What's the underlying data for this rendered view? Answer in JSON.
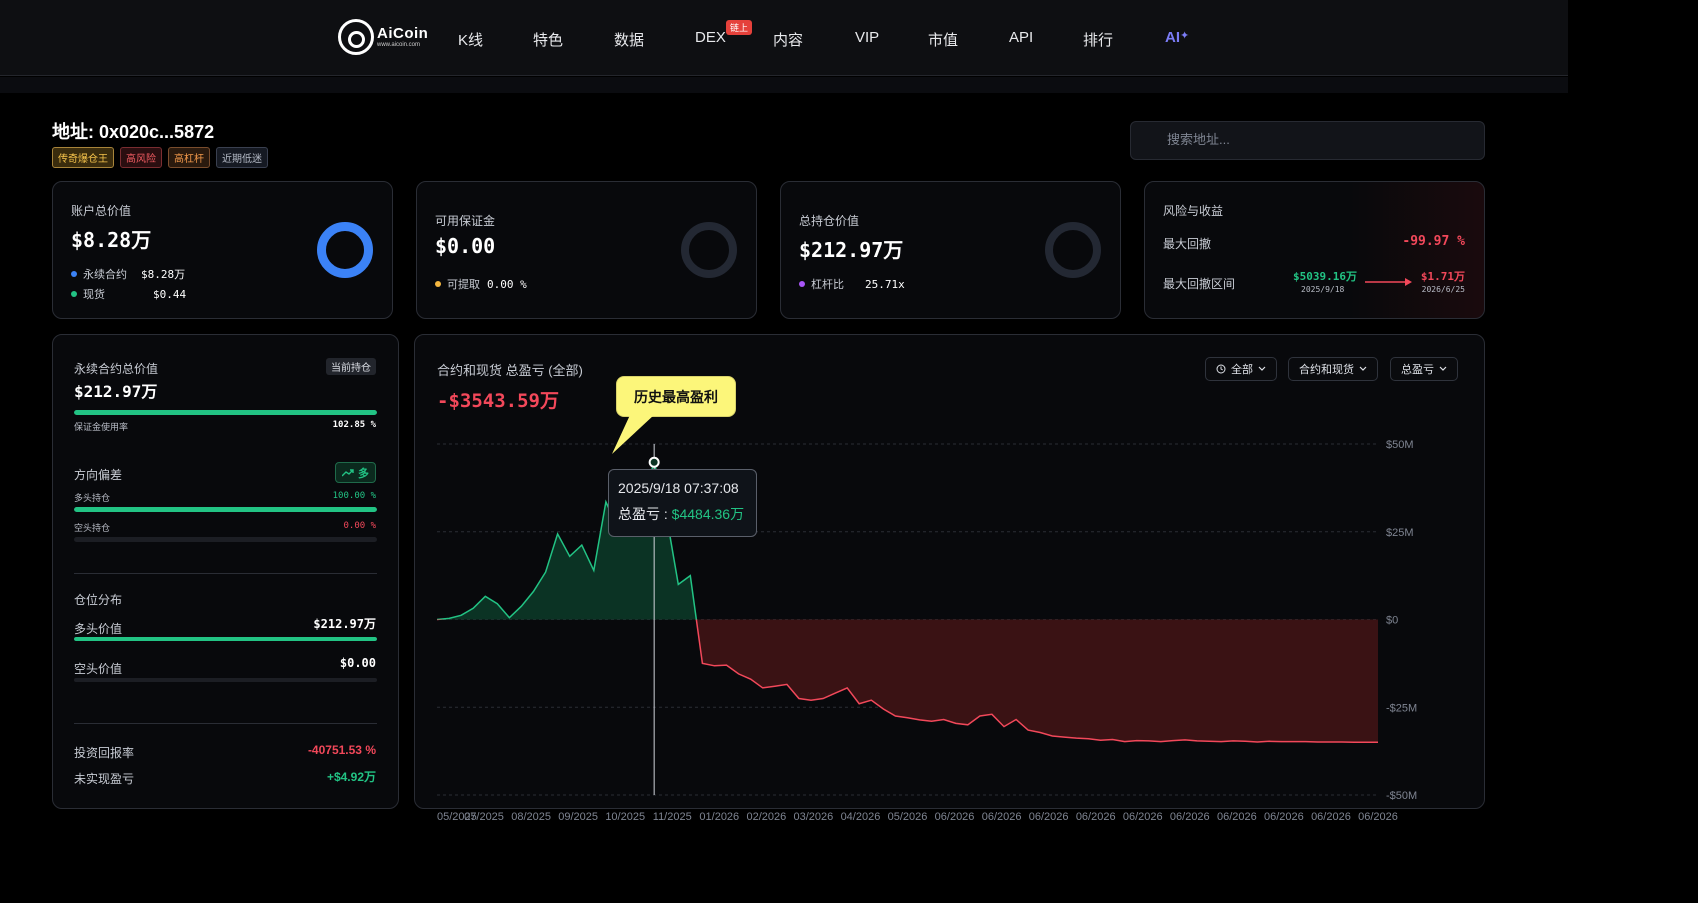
{
  "nav": {
    "logo_text": "AiCoin",
    "logo_sub": "www.aicoin.com",
    "items": [
      "K线",
      "特色",
      "数据",
      "DEX",
      "内容",
      "VIP",
      "市值",
      "API",
      "排行",
      "AI"
    ],
    "dex_badge": "链上",
    "ai_star": "✦"
  },
  "header": {
    "title": "地址: 0x020c...5872",
    "tags": [
      "传奇爆仓王",
      "高风险",
      "高杠杆",
      "近期低迷"
    ],
    "search_placeholder": "搜索地址..."
  },
  "cards": {
    "account": {
      "label": "账户总价值",
      "value": "$8.28万",
      "rows": [
        {
          "label": "永续合约",
          "value": "$8.28万"
        },
        {
          "label": "现货",
          "value": "$0.44"
        }
      ]
    },
    "margin": {
      "label": "可用保证金",
      "value": "$0.00",
      "row_label": "可提取",
      "row_value": "0.00 %"
    },
    "position": {
      "label": "总持仓价值",
      "value": "$212.97万",
      "row_label": "杠杆比",
      "row_value": "25.71x"
    },
    "risk": {
      "label": "风险与收益",
      "max_dd_label": "最大回撤",
      "max_dd_value": "-99.97 %",
      "range_label": "最大回撤区间",
      "from_value": "$5039.16万",
      "from_date": "2025/9/18",
      "to_value": "$1.71万",
      "to_date": "2026/6/25"
    }
  },
  "left": {
    "perp_label": "永续合约总价值",
    "current_badge": "当前持仓",
    "perp_value": "$212.97万",
    "margin_usage_label": "保证金使用率",
    "margin_usage_value": "102.85 %",
    "margin_usage_fraction": 1.0,
    "bias_label": "方向偏差",
    "bias_badge": "多",
    "long_hold_label": "多头持仓",
    "long_hold_value": "100.00 %",
    "long_hold_fraction": 1.0,
    "short_hold_label": "空头持仓",
    "short_hold_value": "0.00 %",
    "short_hold_fraction": 0.0,
    "dist_label": "仓位分布",
    "long_value_label": "多头价值",
    "long_value": "$212.97万",
    "long_value_fraction": 1.0,
    "short_value_label": "空头价值",
    "short_value": "$0.00",
    "short_value_fraction": 0.0,
    "roi_label": "投资回报率",
    "roi_value": "-40751.53 %",
    "unrealized_label": "未实现盈亏",
    "unrealized_value": "+$4.92万"
  },
  "chart_panel": {
    "title": "合约和现货 总盈亏 (全部)",
    "big_value": "-$3543.59万",
    "chip_all": "全部",
    "chip_type": "合约和现货",
    "chip_metric": "总盈亏",
    "callout": "历史最高盈利",
    "tooltip_time": "2025/9/18 07:37:08",
    "tooltip_label": "总盈亏 : ",
    "tooltip_value": "$4484.36万"
  },
  "chart_data": {
    "type": "area",
    "x_ticks": [
      "05/2025",
      "07/2025",
      "08/2025",
      "09/2025",
      "10/2025",
      "11/2025",
      "01/2026",
      "02/2026",
      "03/2026",
      "04/2026",
      "05/2026",
      "06/2026",
      "06/2026",
      "06/2026",
      "06/2026",
      "06/2026",
      "06/2026",
      "06/2026",
      "06/2026",
      "06/2026",
      "06/2026"
    ],
    "y_ticks": [
      "$50M",
      "$25M",
      "$0",
      "-$25M",
      "-$50M"
    ],
    "ylim": [
      -50,
      50
    ],
    "y_unit": "M",
    "peak_index": 18,
    "values": [
      0,
      0.3,
      1.2,
      3.2,
      6.6,
      4.5,
      0.5,
      3.8,
      8.0,
      13.5,
      24.4,
      18.0,
      21.2,
      14.0,
      33.5,
      26.0,
      33.0,
      34.0,
      44.8,
      30.0,
      10.0,
      12.5,
      -12.5,
      -13.2,
      -13.0,
      -15.5,
      -17.0,
      -19.5,
      -19.0,
      -18.5,
      -22.5,
      -23.0,
      -22.5,
      -21.0,
      -19.5,
      -24.0,
      -23.0,
      -25.5,
      -27.5,
      -28.0,
      -28.6,
      -29.0,
      -28.5,
      -29.6,
      -30.0,
      -27.5,
      -27.0,
      -30.5,
      -28.5,
      -31.5,
      -32.2,
      -33.2,
      -33.5,
      -33.8,
      -34.0,
      -34.4,
      -34.2,
      -34.8,
      -34.5,
      -34.6,
      -34.8,
      -34.5,
      -34.3,
      -34.6,
      -34.7,
      -34.8,
      -34.6,
      -34.7,
      -34.9,
      -34.7,
      -34.8,
      -34.8,
      -34.8,
      -34.9,
      -34.9,
      -34.9,
      -35.0,
      -35.0,
      -35.0
    ]
  }
}
